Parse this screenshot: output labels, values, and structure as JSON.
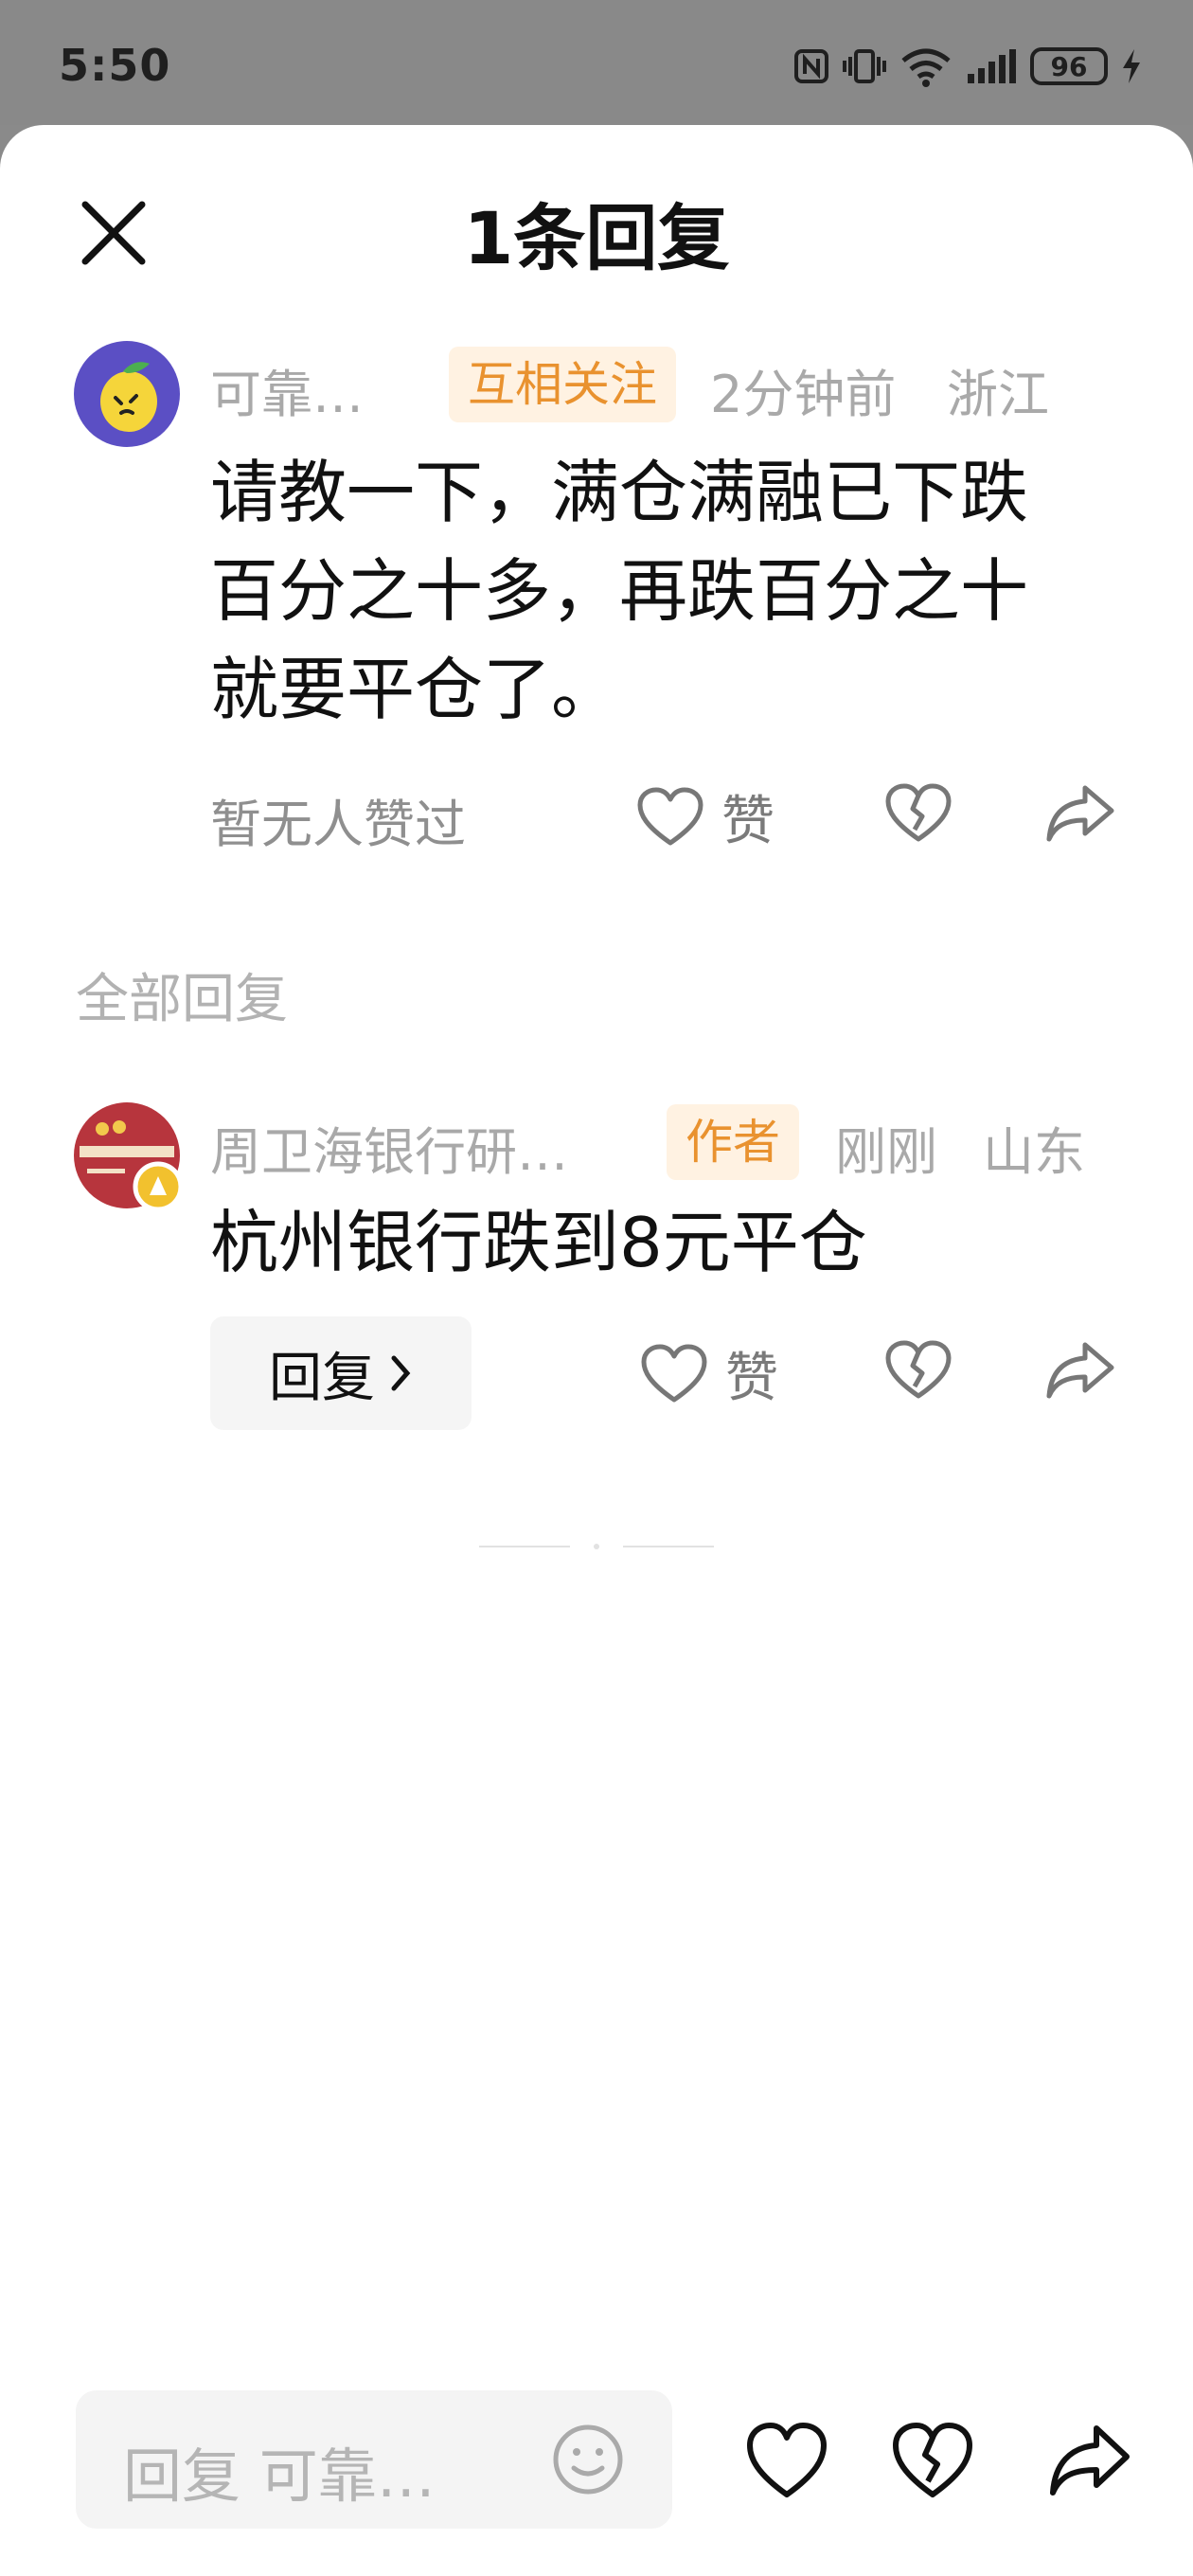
{
  "status_bar": {
    "time": "5:50",
    "battery": "96"
  },
  "header": {
    "title": "1条回复"
  },
  "main_comment": {
    "username": "可靠…",
    "tag": "互相关注",
    "time": "2分钟前",
    "location": "浙江",
    "text": "请教一下，满仓满融已下跌百分之十多，再跌百分之十就要平仓了。",
    "likes_text": "暂无人赞过",
    "like_label": "赞"
  },
  "section": {
    "title": "全部回复"
  },
  "reply": {
    "username": "周卫海银行研…",
    "tag": "作者",
    "time": "刚刚",
    "location": "山东",
    "text": "杭州银行跌到8元平仓",
    "reply_button": "回复",
    "like_label": "赞"
  },
  "bottom_bar": {
    "placeholder": "回复 可靠…"
  },
  "colors": {
    "tag_bg": "#fff2e2",
    "tag_text": "#e9922f",
    "meta_text": "#a9a9a9"
  },
  "icons": {
    "close": "close-icon",
    "like": "heart-icon",
    "dislike": "broken-heart-icon",
    "share": "share-icon",
    "emoji": "emoji-icon",
    "reply_chevron": "chevron-right-icon"
  }
}
